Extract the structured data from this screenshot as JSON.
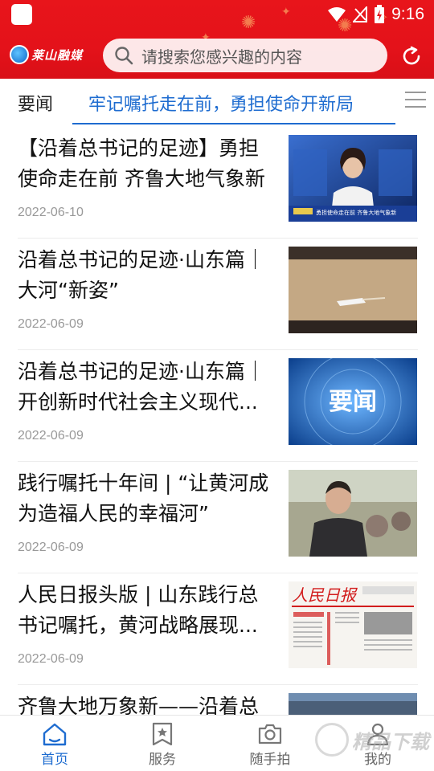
{
  "status_bar": {
    "time": "9:16"
  },
  "header": {
    "logo_text": "莱山融媒",
    "search_placeholder": "请搜索您感兴趣的内容"
  },
  "tabs": {
    "current": "要闻",
    "ticker": "牢记嘱托走在前，勇担使命开新局"
  },
  "news": [
    {
      "title": "【沿着总书记的足迹】勇担使命走在前 齐鲁大地气象新",
      "date": "2022-06-10",
      "thumb_caption": "勇担使命走在前 齐鲁大地气象新"
    },
    {
      "title": "沿着总书记的足迹·山东篇｜大河“新姿”",
      "date": "2022-06-09",
      "thumb_caption": ""
    },
    {
      "title": "沿着总书记的足迹·山东篇｜开创新时代社会主义现代...",
      "date": "2022-06-09",
      "thumb_caption": "要闻"
    },
    {
      "title": "践行嘱托十年间 | “让黄河成为造福人民的幸福河”",
      "date": "2022-06-09",
      "thumb_caption": ""
    },
    {
      "title": "人民日报头版 | 山东践行总书记嘱托，黄河战略展现...",
      "date": "2022-06-09",
      "thumb_caption": "人民日报"
    },
    {
      "title": "齐鲁大地万象新——沿着总",
      "date": "",
      "thumb_caption": ""
    }
  ],
  "bottom_nav": [
    {
      "label": "首页",
      "icon": "home-icon",
      "active": true
    },
    {
      "label": "服务",
      "icon": "bookmark-star-icon",
      "active": false
    },
    {
      "label": "随手拍",
      "icon": "camera-icon",
      "active": false
    },
    {
      "label": "我的",
      "icon": "user-icon",
      "active": false
    }
  ],
  "watermark": {
    "text": "精品下载"
  },
  "colors": {
    "header_red": "#e4121a",
    "accent_blue": "#1e6cd0",
    "date_gray": "#999999"
  }
}
